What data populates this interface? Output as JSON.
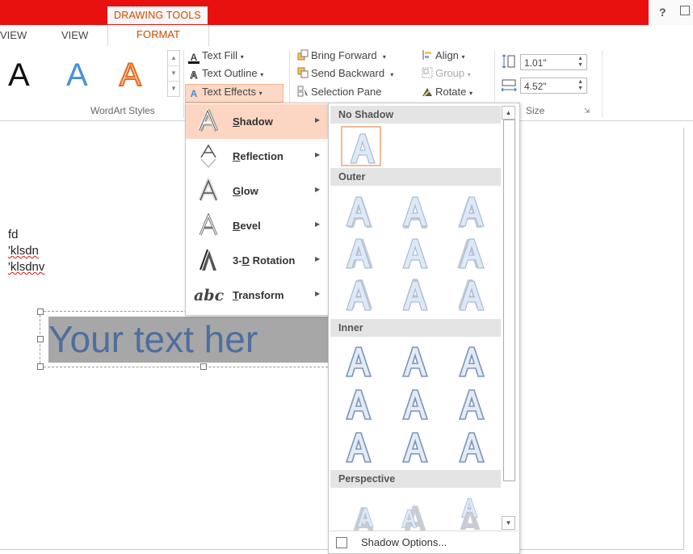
{
  "window": {
    "context_tab": "DRAWING TOOLS",
    "help": "?",
    "tabs": [
      "VIEW",
      "VIEW",
      "FORMAT"
    ]
  },
  "ribbon": {
    "wordart_letter": "A",
    "wordart_group_label": "WordArt Styles",
    "text_fill": "Text Fill",
    "text_outline": "Text Outline",
    "text_effects": "Text Effects",
    "bring_forward": "Bring Forward",
    "send_backward": "Send Backward",
    "selection_pane": "Selection Pane",
    "align": "Align",
    "group": "Group",
    "rotate": "Rotate",
    "height": "1.01\"",
    "width": "4.52\"",
    "size_group_label": "Size"
  },
  "document": {
    "lines": [
      "fd",
      "'klsdn",
      "'klsdnv"
    ],
    "wordart_text": "Your text her"
  },
  "effects_menu": {
    "items": [
      {
        "key": "S",
        "rest": "hadow"
      },
      {
        "key": "R",
        "rest": "eflection"
      },
      {
        "key": "G",
        "rest": "low"
      },
      {
        "key": "B",
        "rest": "evel"
      },
      {
        "pre": "3-",
        "key": "D",
        "rest": " Rotation"
      },
      {
        "key": "T",
        "rest": "ransform"
      }
    ],
    "transform_icon_text": "abc"
  },
  "shadow_gallery": {
    "sections": [
      "No Shadow",
      "Outer",
      "Inner",
      "Perspective"
    ],
    "footer": "Shadow Options..."
  },
  "colors": {
    "title_bar": "#e8110f",
    "accent": "#d04a02",
    "menu_highlight": "#fcd6c2",
    "wordart_blue": "#4e6e9e"
  }
}
